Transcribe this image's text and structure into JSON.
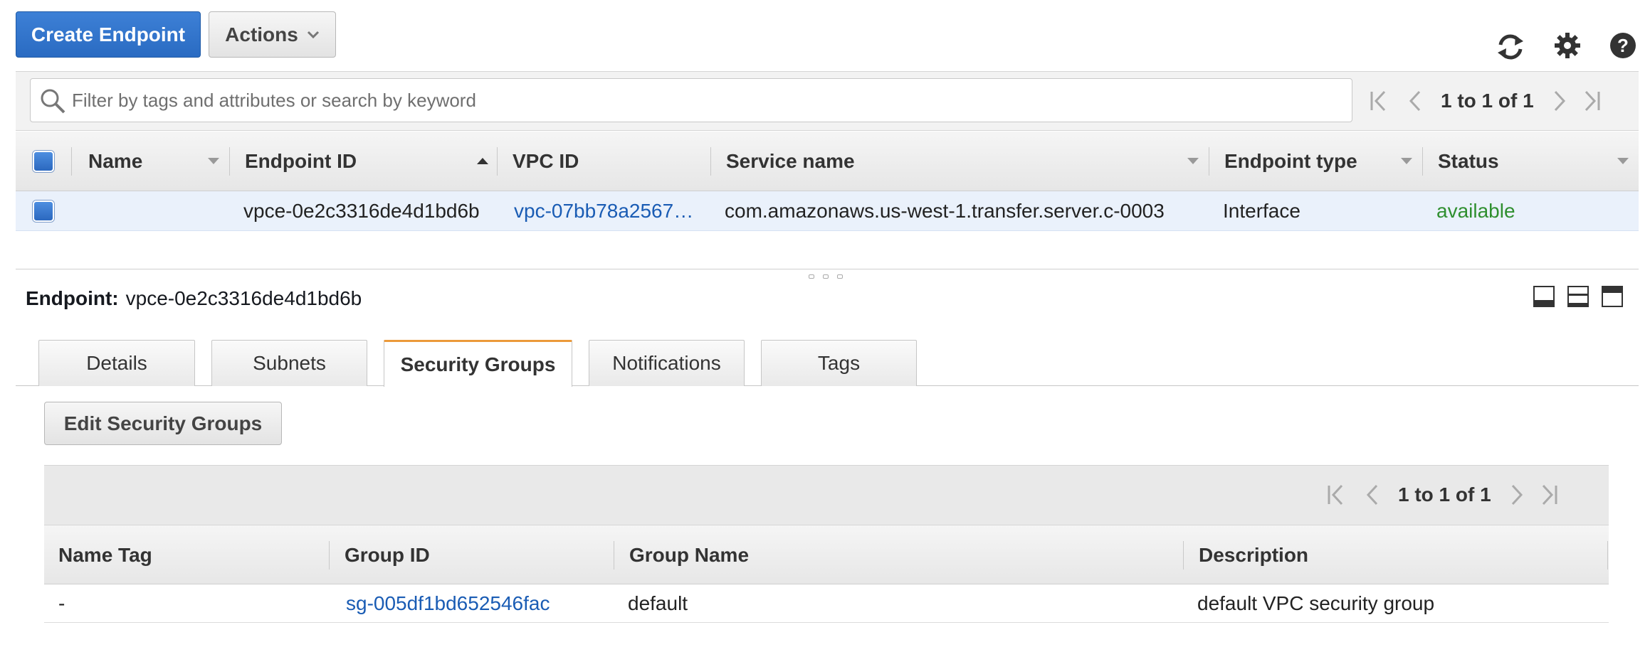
{
  "toolbar": {
    "create_label": "Create Endpoint",
    "actions_label": "Actions"
  },
  "icons": {
    "refresh": "refresh-icon",
    "settings": "gear-icon",
    "help": "help-icon"
  },
  "filter": {
    "placeholder": "Filter by tags and attributes or search by keyword",
    "pager_text": "1 to 1 of 1"
  },
  "table": {
    "columns": {
      "name": "Name",
      "endpoint_id": "Endpoint ID",
      "vpc_id": "VPC ID",
      "service_name": "Service name",
      "endpoint_type": "Endpoint type",
      "status": "Status"
    },
    "rows": [
      {
        "name": "",
        "endpoint_id": "vpce-0e2c3316de4d1bd6b",
        "vpc_id": "vpc-07bb78a2567…",
        "service_name": "com.amazonaws.us-west-1.transfer.server.c-0003",
        "endpoint_type": "Interface",
        "status": "available"
      }
    ]
  },
  "detail": {
    "label": "Endpoint:",
    "value": "vpce-0e2c3316de4d1bd6b",
    "tabs": [
      "Details",
      "Subnets",
      "Security Groups",
      "Notifications",
      "Tags"
    ],
    "active_tab": "Security Groups"
  },
  "security_groups": {
    "edit_label": "Edit Security Groups",
    "pager_text": "1 to 1 of 1",
    "columns": {
      "name_tag": "Name Tag",
      "group_id": "Group ID",
      "group_name": "Group Name",
      "description": "Description"
    },
    "rows": [
      {
        "name_tag": "-",
        "group_id": "sg-005df1bd652546fac",
        "group_name": "default",
        "description": "default VPC security group"
      }
    ]
  },
  "colors": {
    "primary_button": "#2a6bc2",
    "link": "#1a5cb4",
    "status_ok": "#2f8f2f",
    "active_tab_accent": "#ec9a3a"
  }
}
